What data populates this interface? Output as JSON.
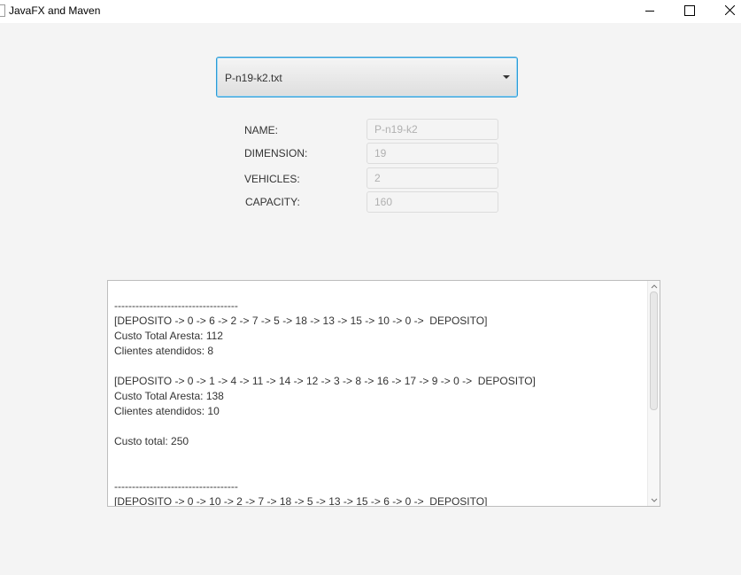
{
  "window": {
    "title": "JavaFX and Maven"
  },
  "selector": {
    "value": "P-n19-k2.txt"
  },
  "fields": [
    {
      "label": "NAME:",
      "value": "P-n19-k2"
    },
    {
      "label": "DIMENSION:",
      "value": "19"
    },
    {
      "label": "VEHICLES:",
      "value": "2"
    },
    {
      "label": "CAPACITY:",
      "value": "160"
    }
  ],
  "output": {
    "text": "-----------------------------------\n[DEPOSITO -> 0 -> 6 -> 2 -> 7 -> 5 -> 18 -> 13 -> 15 -> 10 -> 0 ->  DEPOSITO]\nCusto Total Aresta: 112\nClientes atendidos: 8\n\n[DEPOSITO -> 0 -> 1 -> 4 -> 11 -> 14 -> 12 -> 3 -> 8 -> 16 -> 17 -> 9 -> 0 ->  DEPOSITO]\nCusto Total Aresta: 138\nClientes atendidos: 10\n\nCusto total: 250\n\n\n-----------------------------------\n[DEPOSITO -> 0 -> 10 -> 2 -> 7 -> 18 -> 5 -> 13 -> 15 -> 6 -> 0 ->  DEPOSITO]"
  }
}
